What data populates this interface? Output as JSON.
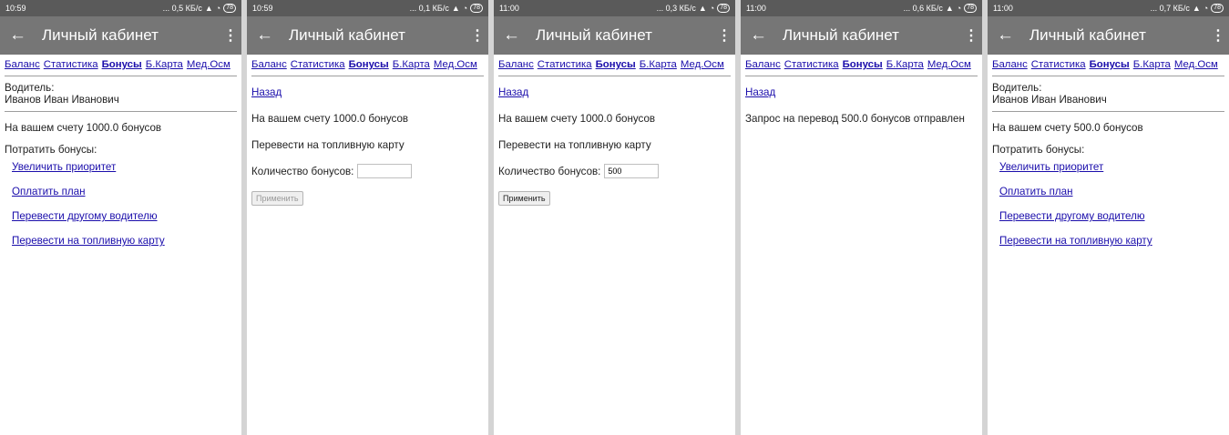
{
  "common": {
    "app_title": "Личный кабинет",
    "nav": [
      "Баланс",
      "Статистика",
      "Бонусы",
      "Б.Карта",
      "Мед.Осм"
    ],
    "back_link": "Назад",
    "driver_label": "Водитель:",
    "driver_name": "Иванов Иван Иванович",
    "spend_label": "Потратить бонусы:",
    "spend_options": [
      "Увеличить приоритет",
      "Оплатить план",
      "Перевести другому водителю",
      "Перевести на топливную карту"
    ],
    "transfer_title": "Перевести на топливную карту",
    "quantity_label": "Количество бонусов:",
    "apply_button": "Применить"
  },
  "screens": [
    {
      "time": "10:59",
      "net": "... 0,5 КБ/с",
      "battery": "78",
      "balance_text": "На вашем счету 1000.0 бонусов"
    },
    {
      "time": "10:59",
      "net": "... 0,1 КБ/с",
      "battery": "78",
      "balance_text": "На вашем счету 1000.0 бонусов",
      "quantity_value": ""
    },
    {
      "time": "11:00",
      "net": "... 0,3 КБ/с",
      "battery": "78",
      "balance_text": "На вашем счету 1000.0 бонусов",
      "quantity_value": "500"
    },
    {
      "time": "11:00",
      "net": "... 0,6 КБ/с",
      "battery": "78",
      "message": "Запрос на перевод 500.0 бонусов отправлен"
    },
    {
      "time": "11:00",
      "net": "... 0,7 КБ/с",
      "battery": "78",
      "balance_text": "На вашем счету 500.0 бонусов"
    }
  ]
}
